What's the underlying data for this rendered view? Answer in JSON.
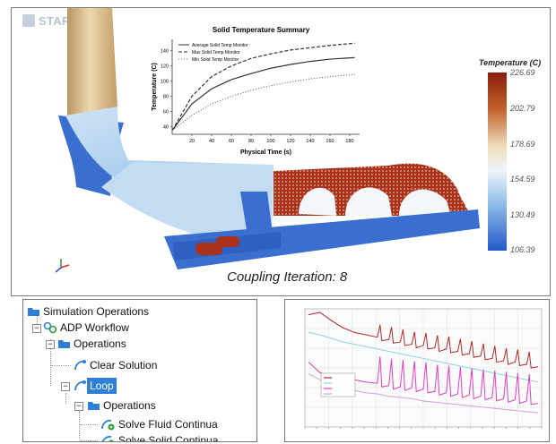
{
  "brand": {
    "name": "STAR-CCM+"
  },
  "viewport": {
    "coupling_text": "Coupling Iteration: 8",
    "legend": {
      "title": "Temperature (C)",
      "ticks": [
        "226.69",
        "202.79",
        "178.69",
        "154.59",
        "130.49",
        "106.39"
      ]
    }
  },
  "chart_data": [
    {
      "type": "line",
      "title": "Solid Temperature Summary",
      "xlabel": "Physical Time (s)",
      "ylabel": "Temperature (C)",
      "xlim": [
        0,
        190
      ],
      "ylim": [
        30,
        155
      ],
      "xticks": [
        20,
        40,
        60,
        80,
        100,
        120,
        140,
        160,
        180
      ],
      "yticks": [
        40,
        60,
        80,
        100,
        120,
        140
      ],
      "grid": false,
      "legend_position": "top-left",
      "series": [
        {
          "name": "Average Solid Temp Monitor",
          "style": "solid",
          "x": [
            0,
            20,
            40,
            60,
            80,
            100,
            120,
            140,
            160,
            185
          ],
          "y": [
            35,
            70,
            90,
            102,
            110,
            117,
            122,
            126,
            129,
            131
          ]
        },
        {
          "name": "Max Solid Temp Monitor",
          "style": "dashed",
          "x": [
            0,
            20,
            40,
            60,
            80,
            100,
            120,
            140,
            160,
            185
          ],
          "y": [
            35,
            80,
            106,
            120,
            130,
            136,
            141,
            144,
            147,
            150
          ]
        },
        {
          "name": "Min Solid Temp Monitor",
          "style": "dotted",
          "x": [
            0,
            20,
            40,
            60,
            80,
            100,
            120,
            140,
            160,
            185
          ],
          "y": [
            35,
            55,
            70,
            80,
            88,
            94,
            99,
            103,
            106,
            109
          ]
        }
      ]
    },
    {
      "type": "line",
      "grid": true,
      "legend_position": "center-left",
      "series": [
        {
          "color": "#b02a2a",
          "y": [
            0.95,
            0.97,
            0.9,
            0.84,
            0.8,
            0.78,
            0.76,
            0.74,
            0.72,
            0.7,
            0.69,
            0.67,
            0.66,
            0.64,
            0.62,
            0.6,
            0.58,
            0.56,
            0.55,
            0.53,
            0.51
          ]
        },
        {
          "color": "#8fd3d8",
          "y": [
            0.8,
            0.78,
            0.75,
            0.72,
            0.7,
            0.68,
            0.66,
            0.64,
            0.62,
            0.6,
            0.58,
            0.56,
            0.54,
            0.52,
            0.5,
            0.48,
            0.46,
            0.44,
            0.42,
            0.4,
            0.38
          ]
        },
        {
          "color": "#e040c0",
          "y": [
            0.55,
            0.46,
            0.43,
            0.41,
            0.4,
            0.38,
            0.37,
            0.35,
            0.34,
            0.33,
            0.32,
            0.3,
            0.29,
            0.28,
            0.27,
            0.26,
            0.25,
            0.24,
            0.23,
            0.22,
            0.2
          ]
        },
        {
          "color": "#c9a2d8",
          "y": [
            0.45,
            0.4,
            0.36,
            0.33,
            0.31,
            0.29,
            0.28,
            0.26,
            0.25,
            0.24,
            0.22,
            0.21,
            0.2,
            0.19,
            0.18,
            0.17,
            0.16,
            0.15,
            0.14,
            0.13,
            0.12
          ]
        }
      ]
    }
  ],
  "tree": {
    "items": [
      {
        "label": "Simulation Operations",
        "icon": "folder-icon"
      },
      {
        "label": "ADP Workflow",
        "icon": "workflow-icon"
      },
      {
        "label": "Operations",
        "icon": "folder-icon"
      },
      {
        "label": "Clear Solution",
        "icon": "operation-icon"
      },
      {
        "label": "Loop",
        "icon": "loop-icon",
        "selected": true
      },
      {
        "label": "Operations",
        "icon": "folder-icon"
      },
      {
        "label": "Solve Fluid Continua",
        "icon": "solve-icon"
      },
      {
        "label": "Solve Solid Continua",
        "icon": "solve-icon"
      }
    ]
  },
  "colors": {
    "selection": "#2f7fd8",
    "steel": "#3a6fd0",
    "hot": "#a8321c",
    "pipe": "#d8b98a"
  }
}
